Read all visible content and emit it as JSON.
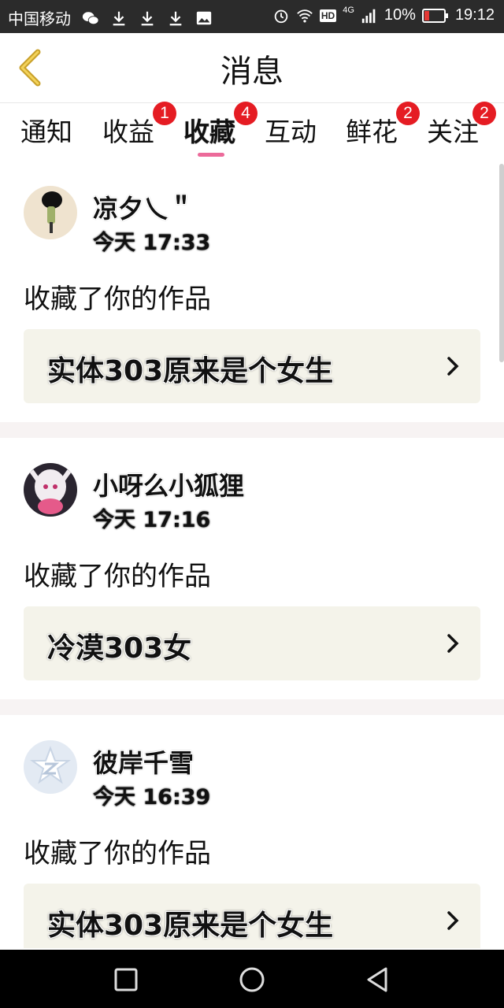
{
  "status_bar": {
    "carrier": "中国移动",
    "battery_percent": "10%",
    "time": "19:12",
    "network": "4G",
    "hd": "HD",
    "icons": [
      "wechat-icon",
      "download-icon",
      "download-icon",
      "download-icon",
      "image-icon",
      "alarm-icon",
      "wifi-icon",
      "signal-icon",
      "battery-icon"
    ]
  },
  "header": {
    "title": "消息",
    "back_icon": "chevron-left-icon"
  },
  "tabs": [
    {
      "label": "通知",
      "badge": ""
    },
    {
      "label": "收益",
      "badge": "1"
    },
    {
      "label": "收藏",
      "badge": "4"
    },
    {
      "label": "互动",
      "badge": ""
    },
    {
      "label": "鲜花",
      "badge": "2"
    },
    {
      "label": "关注",
      "badge": "2"
    }
  ],
  "active_tab": "收藏",
  "accent_color": "#ec6a9a",
  "badge_color": "#e51c23",
  "messages": [
    {
      "user": "凉夕乀＂",
      "time": "今天 17:33",
      "action": "收藏了你的作品",
      "work": "实体303原来是个女生"
    },
    {
      "user": "小呀么小狐狸",
      "time": "今天 17:16",
      "action": "收藏了你的作品",
      "work": "冷漠303女"
    },
    {
      "user": "彼岸千雪",
      "time": "今天 16:39",
      "action": "收藏了你的作品",
      "work": "实体303原来是个女生"
    }
  ],
  "navbar": [
    "square-icon",
    "circle-icon",
    "triangle-back-icon"
  ]
}
